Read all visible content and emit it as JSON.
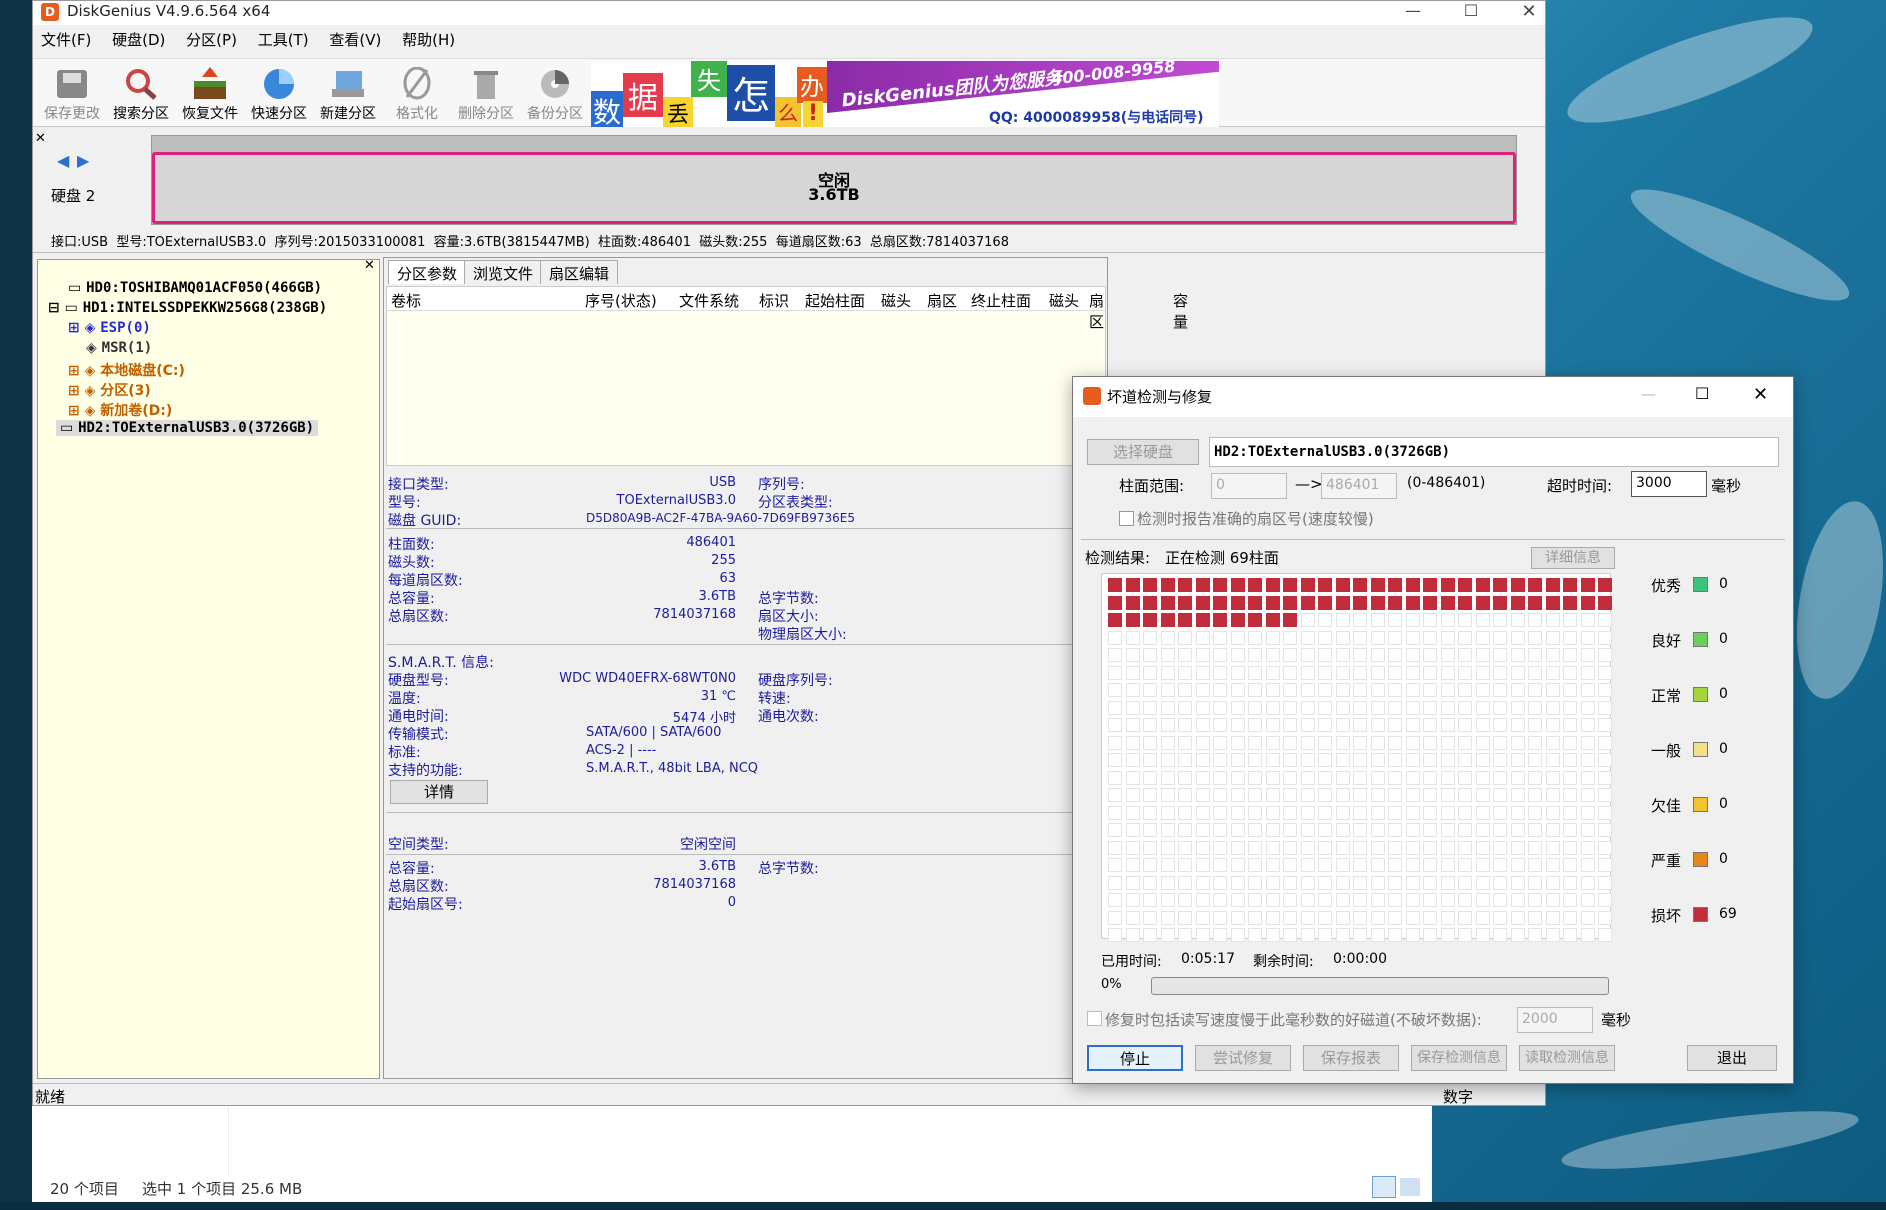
{
  "window": {
    "title": "DiskGenius V4.9.6.564 x64"
  },
  "menu": [
    "文件(F)",
    "硬盘(D)",
    "分区(P)",
    "工具(T)",
    "查看(V)",
    "帮助(H)"
  ],
  "toolbar": [
    {
      "label": "保存更改",
      "icon": "save-icon",
      "enabled": false
    },
    {
      "label": "搜索分区",
      "icon": "search-icon",
      "enabled": true
    },
    {
      "label": "恢复文件",
      "icon": "recover-icon",
      "enabled": true
    },
    {
      "label": "快速分区",
      "icon": "quick-partition-icon",
      "enabled": true
    },
    {
      "label": "新建分区",
      "icon": "new-partition-icon",
      "enabled": true
    },
    {
      "label": "格式化",
      "icon": "format-icon",
      "enabled": false
    },
    {
      "label": "删除分区",
      "icon": "delete-icon",
      "enabled": false
    },
    {
      "label": "备份分区",
      "icon": "backup-icon",
      "enabled": false
    }
  ],
  "banner": {
    "chars": [
      "数",
      "据",
      "丢",
      "失",
      "怎",
      "么",
      "办",
      "!"
    ],
    "brand": "DiskGenius团队为您服务",
    "phone": "400-008-9958",
    "qq": "QQ: 4000089958(与电话同号)"
  },
  "disk_map": {
    "label": "硬盘 2",
    "free_title": "空闲",
    "free_size": "3.6TB"
  },
  "disk_info": "接口:USB  型号:TOExternalUSB3.0  序列号:2015033100081  容量:3.6TB(3815447MB)  柱面数:486401  磁头数:255  每道扇区数:63  总扇区数:7814037168",
  "tree": {
    "hd0": "HD0:TOSHIBAMQ01ACF050(466GB)",
    "hd1": "HD1:INTELSSDPEKKW256G8(238GB)",
    "esp": "ESP(0)",
    "msr": "MSR(1)",
    "c": "本地磁盘(C:)",
    "p3": "分区(3)",
    "d": "新加卷(D:)",
    "hd2": "HD2:TOExternalUSB3.0(3726GB)"
  },
  "tabs": [
    "分区参数",
    "浏览文件",
    "扇区编辑"
  ],
  "columns": [
    "卷标",
    "序号(状态)",
    "文件系统",
    "标识",
    "起始柱面",
    "磁头",
    "扇区",
    "终止柱面",
    "磁头",
    "扇区",
    "容量"
  ],
  "props": {
    "interface_label": "接口类型:",
    "interface_value": "USB",
    "serial_label": "序列号:",
    "model_label": "型号:",
    "model_value": "TOExternalUSB3.0",
    "pt_label": "分区表类型:",
    "guid_label": "磁盘 GUID:",
    "guid_value": "D5D80A9B-AC2F-47BA-9A60-7D69FB9736E5",
    "cyl_label": "柱面数:",
    "cyl_value": "486401",
    "heads_label": "磁头数:",
    "heads_value": "255",
    "spt_label": "每道扇区数:",
    "spt_value": "63",
    "cap_label": "总容量:",
    "cap_value": "3.6TB",
    "bytes_label": "总字节数:",
    "sectors_label": "总扇区数:",
    "sectors_value": "7814037168",
    "secsize_label": "扇区大小:",
    "physsec_label": "物理扇区大小:",
    "smart_title": "S.M.A.R.T. 信息:",
    "smodel_label": "硬盘型号:",
    "smodel_value": "WDC WD40EFRX-68WT0N0",
    "sserial_label": "硬盘序列号:",
    "temp_label": "温度:",
    "temp_value": "31 ℃",
    "rpm_label": "转速:",
    "hours_label": "通电时间:",
    "hours_value": "5474 小时",
    "count_label": "通电次数:",
    "mode_label": "传输模式:",
    "mode_value": "SATA/600 | SATA/600",
    "std_label": "标准:",
    "std_value": "ACS-2 | ----",
    "feat_label": "支持的功能:",
    "feat_value": "S.M.A.R.T., 48bit LBA, NCQ",
    "detail_button": "详情",
    "space_label": "空间类型:",
    "space_value": "空闲空间",
    "cap2_label": "总容量:",
    "cap2_value": "3.6TB",
    "bytes2_label": "总字节数:",
    "sectors2_label": "总扇区数:",
    "sectors2_value": "7814037168",
    "start_label": "起始扇区号:",
    "start_value": "0"
  },
  "status": {
    "left": "就绪",
    "right": "数字"
  },
  "explorer": {
    "items": "20 个项目",
    "selected": "选中 1 个项目  25.6 MB"
  },
  "dialog": {
    "title": "坏道检测与修复",
    "select_disk": "选择硬盘",
    "disk": "HD2:TOExternalUSB3.0(3726GB)",
    "cyl_range_label": "柱面范围:",
    "cyl_from": "0",
    "arrow": "—>",
    "cyl_to": "486401",
    "cyl_hint": "(0-486401)",
    "timeout_label": "超时时间:",
    "timeout": "3000",
    "ms": "毫秒",
    "accurate_label": "检测时报告准确的扇区号(速度较慢)",
    "result_label": "检测结果:",
    "result_status": "正在检测 69柱面",
    "details_button": "详细信息",
    "elapsed_label": "已用时间:",
    "elapsed": "0:05:17",
    "remaining_label": "剩余时间:",
    "remaining": "0:00:00",
    "progress_text": "0%",
    "progress": 0,
    "repair_label": "修复时包括读写速度慢于此毫秒数的好磁道(不破坏数据):",
    "repair_ms": "2000",
    "repair_unit": "毫秒",
    "buttons": {
      "stop": "停止",
      "try_repair": "尝试修复",
      "save_report": "保存报表",
      "save_info": "保存检测信息",
      "read_info": "读取检测信息",
      "exit": "退出"
    },
    "bad_count": 69,
    "legend": [
      {
        "label": "优秀",
        "color": "#3cc47f",
        "count": "0"
      },
      {
        "label": "良好",
        "color": "#6ccf5a",
        "count": "0"
      },
      {
        "label": "正常",
        "color": "#a6d43c",
        "count": "0"
      },
      {
        "label": "一般",
        "color": "#f5e08a",
        "count": "0"
      },
      {
        "label": "欠佳",
        "color": "#f2c530",
        "count": "0"
      },
      {
        "label": "严重",
        "color": "#e8861a",
        "count": "0"
      },
      {
        "label": "损坏",
        "color": "#c22b3c",
        "count": "69"
      }
    ]
  }
}
